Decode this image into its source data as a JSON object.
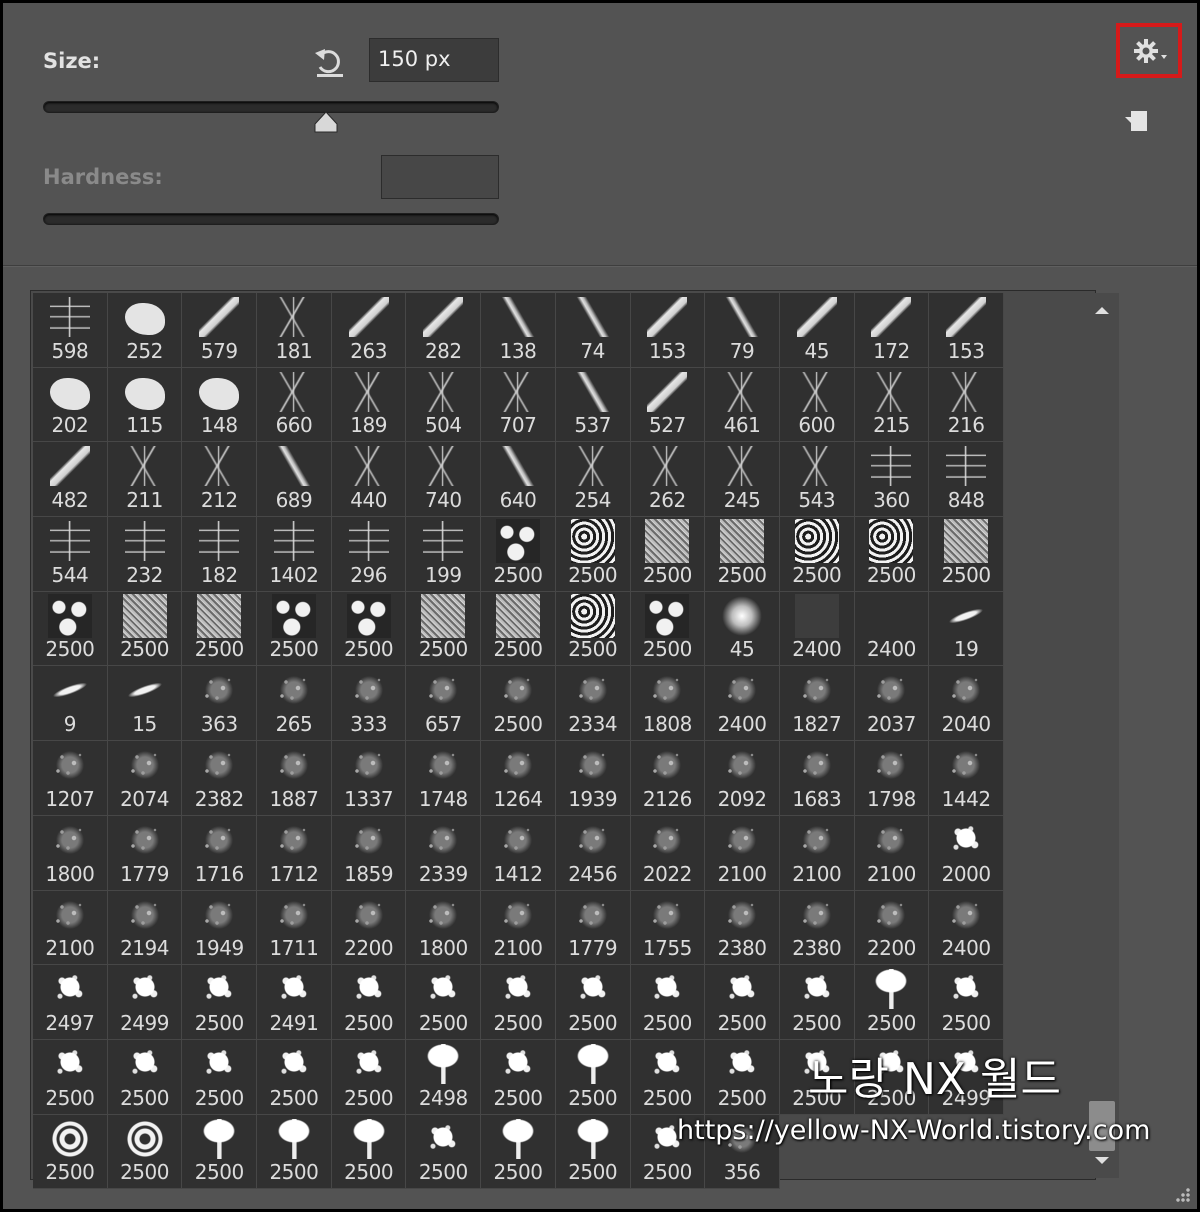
{
  "size": {
    "label": "Size:",
    "value": "150 px",
    "slider_fraction": 0.62
  },
  "hardness": {
    "label": "Hardness:",
    "value": ""
  },
  "watermark": {
    "title": "노랑 NX 월드",
    "url": "https://yellow-NX-World.tistory.com"
  },
  "colors": {
    "panel": "#535353",
    "cell": "#303030",
    "highlight_border": "#d61a1a"
  },
  "icons": {
    "reset": "reset-icon",
    "settings": "gear-icon",
    "new_preset": "new-preset-icon",
    "scroll_up": "up-arrow-icon",
    "scroll_down": "down-arrow-icon"
  },
  "brushes": [
    {
      "size": "598",
      "thumb": "glyph"
    },
    {
      "size": "252",
      "thumb": "blob"
    },
    {
      "size": "579",
      "thumb": "stroke"
    },
    {
      "size": "181",
      "thumb": "bamboo"
    },
    {
      "size": "263",
      "thumb": "stroke"
    },
    {
      "size": "282",
      "thumb": "stroke"
    },
    {
      "size": "138",
      "thumb": "stroke2"
    },
    {
      "size": "74",
      "thumb": "stroke2"
    },
    {
      "size": "153",
      "thumb": "stroke"
    },
    {
      "size": "79",
      "thumb": "stroke2"
    },
    {
      "size": "45",
      "thumb": "stroke"
    },
    {
      "size": "172",
      "thumb": "stroke"
    },
    {
      "size": "153",
      "thumb": "stroke"
    },
    {
      "size": "202",
      "thumb": "blob"
    },
    {
      "size": "115",
      "thumb": "blob"
    },
    {
      "size": "148",
      "thumb": "blob"
    },
    {
      "size": "660",
      "thumb": "bamboo"
    },
    {
      "size": "189",
      "thumb": "bamboo"
    },
    {
      "size": "504",
      "thumb": "bamboo"
    },
    {
      "size": "707",
      "thumb": "bamboo"
    },
    {
      "size": "537",
      "thumb": "stroke2"
    },
    {
      "size": "527",
      "thumb": "stroke"
    },
    {
      "size": "461",
      "thumb": "bamboo"
    },
    {
      "size": "600",
      "thumb": "bamboo"
    },
    {
      "size": "215",
      "thumb": "bamboo"
    },
    {
      "size": "216",
      "thumb": "bamboo"
    },
    {
      "size": "482",
      "thumb": "stroke"
    },
    {
      "size": "211",
      "thumb": "bamboo"
    },
    {
      "size": "212",
      "thumb": "bamboo"
    },
    {
      "size": "689",
      "thumb": "stroke2"
    },
    {
      "size": "440",
      "thumb": "bamboo"
    },
    {
      "size": "740",
      "thumb": "bamboo"
    },
    {
      "size": "640",
      "thumb": "stroke2"
    },
    {
      "size": "254",
      "thumb": "bamboo"
    },
    {
      "size": "262",
      "thumb": "bamboo"
    },
    {
      "size": "245",
      "thumb": "bamboo"
    },
    {
      "size": "543",
      "thumb": "bamboo"
    },
    {
      "size": "360",
      "thumb": "glyph"
    },
    {
      "size": "848",
      "thumb": "glyph"
    },
    {
      "size": "544",
      "thumb": "glyph"
    },
    {
      "size": "232",
      "thumb": "glyph"
    },
    {
      "size": "182",
      "thumb": "glyph"
    },
    {
      "size": "1402",
      "thumb": "glyph"
    },
    {
      "size": "296",
      "thumb": "glyph"
    },
    {
      "size": "199",
      "thumb": "glyph"
    },
    {
      "size": "2500",
      "thumb": "tex3"
    },
    {
      "size": "2500",
      "thumb": "tex"
    },
    {
      "size": "2500",
      "thumb": "tex2"
    },
    {
      "size": "2500",
      "thumb": "tex2"
    },
    {
      "size": "2500",
      "thumb": "tex"
    },
    {
      "size": "2500",
      "thumb": "tex"
    },
    {
      "size": "2500",
      "thumb": "tex2"
    },
    {
      "size": "2500",
      "thumb": "tex3"
    },
    {
      "size": "2500",
      "thumb": "tex2"
    },
    {
      "size": "2500",
      "thumb": "tex2"
    },
    {
      "size": "2500",
      "thumb": "tex3"
    },
    {
      "size": "2500",
      "thumb": "tex3"
    },
    {
      "size": "2500",
      "thumb": "tex2"
    },
    {
      "size": "2500",
      "thumb": "tex2"
    },
    {
      "size": "2500",
      "thumb": "tex"
    },
    {
      "size": "2500",
      "thumb": "tex3"
    },
    {
      "size": "45",
      "thumb": "soft"
    },
    {
      "size": "2400",
      "thumb": "flat"
    },
    {
      "size": "2400",
      "thumb": "none"
    },
    {
      "size": "19",
      "thumb": "dash"
    },
    {
      "size": "9",
      "thumb": "dash"
    },
    {
      "size": "15",
      "thumb": "dash"
    },
    {
      "size": "363",
      "thumb": "scatter"
    },
    {
      "size": "265",
      "thumb": "scatter"
    },
    {
      "size": "333",
      "thumb": "scatter"
    },
    {
      "size": "657",
      "thumb": "scatter"
    },
    {
      "size": "2500",
      "thumb": "scatter"
    },
    {
      "size": "2334",
      "thumb": "scatter"
    },
    {
      "size": "1808",
      "thumb": "scatter"
    },
    {
      "size": "2400",
      "thumb": "scatter"
    },
    {
      "size": "1827",
      "thumb": "scatter"
    },
    {
      "size": "2037",
      "thumb": "scatter"
    },
    {
      "size": "2040",
      "thumb": "scatter"
    },
    {
      "size": "1207",
      "thumb": "scatter"
    },
    {
      "size": "2074",
      "thumb": "scatter"
    },
    {
      "size": "2382",
      "thumb": "scatter"
    },
    {
      "size": "1887",
      "thumb": "scatter"
    },
    {
      "size": "1337",
      "thumb": "scatter"
    },
    {
      "size": "1748",
      "thumb": "scatter"
    },
    {
      "size": "1264",
      "thumb": "scatter"
    },
    {
      "size": "1939",
      "thumb": "scatter"
    },
    {
      "size": "2126",
      "thumb": "scatter"
    },
    {
      "size": "2092",
      "thumb": "scatter"
    },
    {
      "size": "1683",
      "thumb": "scatter"
    },
    {
      "size": "1798",
      "thumb": "scatter"
    },
    {
      "size": "1442",
      "thumb": "scatter"
    },
    {
      "size": "1800",
      "thumb": "scatter"
    },
    {
      "size": "1779",
      "thumb": "scatter"
    },
    {
      "size": "1716",
      "thumb": "scatter"
    },
    {
      "size": "1712",
      "thumb": "scatter"
    },
    {
      "size": "1859",
      "thumb": "scatter"
    },
    {
      "size": "2339",
      "thumb": "scatter"
    },
    {
      "size": "1412",
      "thumb": "scatter"
    },
    {
      "size": "2456",
      "thumb": "scatter"
    },
    {
      "size": "2022",
      "thumb": "scatter"
    },
    {
      "size": "2100",
      "thumb": "scatter"
    },
    {
      "size": "2100",
      "thumb": "scatter"
    },
    {
      "size": "2100",
      "thumb": "scatter"
    },
    {
      "size": "2000",
      "thumb": "splat"
    },
    {
      "size": "2100",
      "thumb": "scatter"
    },
    {
      "size": "2194",
      "thumb": "scatter"
    },
    {
      "size": "1949",
      "thumb": "scatter"
    },
    {
      "size": "1711",
      "thumb": "scatter"
    },
    {
      "size": "2200",
      "thumb": "scatter"
    },
    {
      "size": "1800",
      "thumb": "scatter"
    },
    {
      "size": "2100",
      "thumb": "scatter"
    },
    {
      "size": "1779",
      "thumb": "scatter"
    },
    {
      "size": "1755",
      "thumb": "scatter"
    },
    {
      "size": "2380",
      "thumb": "scatter"
    },
    {
      "size": "2380",
      "thumb": "scatter"
    },
    {
      "size": "2200",
      "thumb": "scatter"
    },
    {
      "size": "2400",
      "thumb": "scatter"
    },
    {
      "size": "2497",
      "thumb": "splat"
    },
    {
      "size": "2499",
      "thumb": "splat"
    },
    {
      "size": "2500",
      "thumb": "splat"
    },
    {
      "size": "2491",
      "thumb": "splat"
    },
    {
      "size": "2500",
      "thumb": "splat"
    },
    {
      "size": "2500",
      "thumb": "splat"
    },
    {
      "size": "2500",
      "thumb": "splat"
    },
    {
      "size": "2500",
      "thumb": "splat"
    },
    {
      "size": "2500",
      "thumb": "splat"
    },
    {
      "size": "2500",
      "thumb": "splat"
    },
    {
      "size": "2500",
      "thumb": "splat"
    },
    {
      "size": "2500",
      "thumb": "drip"
    },
    {
      "size": "2500",
      "thumb": "splat"
    },
    {
      "size": "2500",
      "thumb": "splat"
    },
    {
      "size": "2500",
      "thumb": "splat"
    },
    {
      "size": "2500",
      "thumb": "splat"
    },
    {
      "size": "2500",
      "thumb": "splat"
    },
    {
      "size": "2500",
      "thumb": "splat"
    },
    {
      "size": "2498",
      "thumb": "drip"
    },
    {
      "size": "2500",
      "thumb": "splat"
    },
    {
      "size": "2500",
      "thumb": "drip"
    },
    {
      "size": "2500",
      "thumb": "splat"
    },
    {
      "size": "2500",
      "thumb": "splat"
    },
    {
      "size": "2500",
      "thumb": "splat"
    },
    {
      "size": "2500",
      "thumb": "splat"
    },
    {
      "size": "2499",
      "thumb": "splat"
    },
    {
      "size": "2500",
      "thumb": "swirl"
    },
    {
      "size": "2500",
      "thumb": "swirl"
    },
    {
      "size": "2500",
      "thumb": "drip"
    },
    {
      "size": "2500",
      "thumb": "drip"
    },
    {
      "size": "2500",
      "thumb": "drip"
    },
    {
      "size": "2500",
      "thumb": "splat"
    },
    {
      "size": "2500",
      "thumb": "drip"
    },
    {
      "size": "2500",
      "thumb": "drip"
    },
    {
      "size": "2500",
      "thumb": "splat"
    },
    {
      "size": "356",
      "thumb": "scatter"
    }
  ]
}
